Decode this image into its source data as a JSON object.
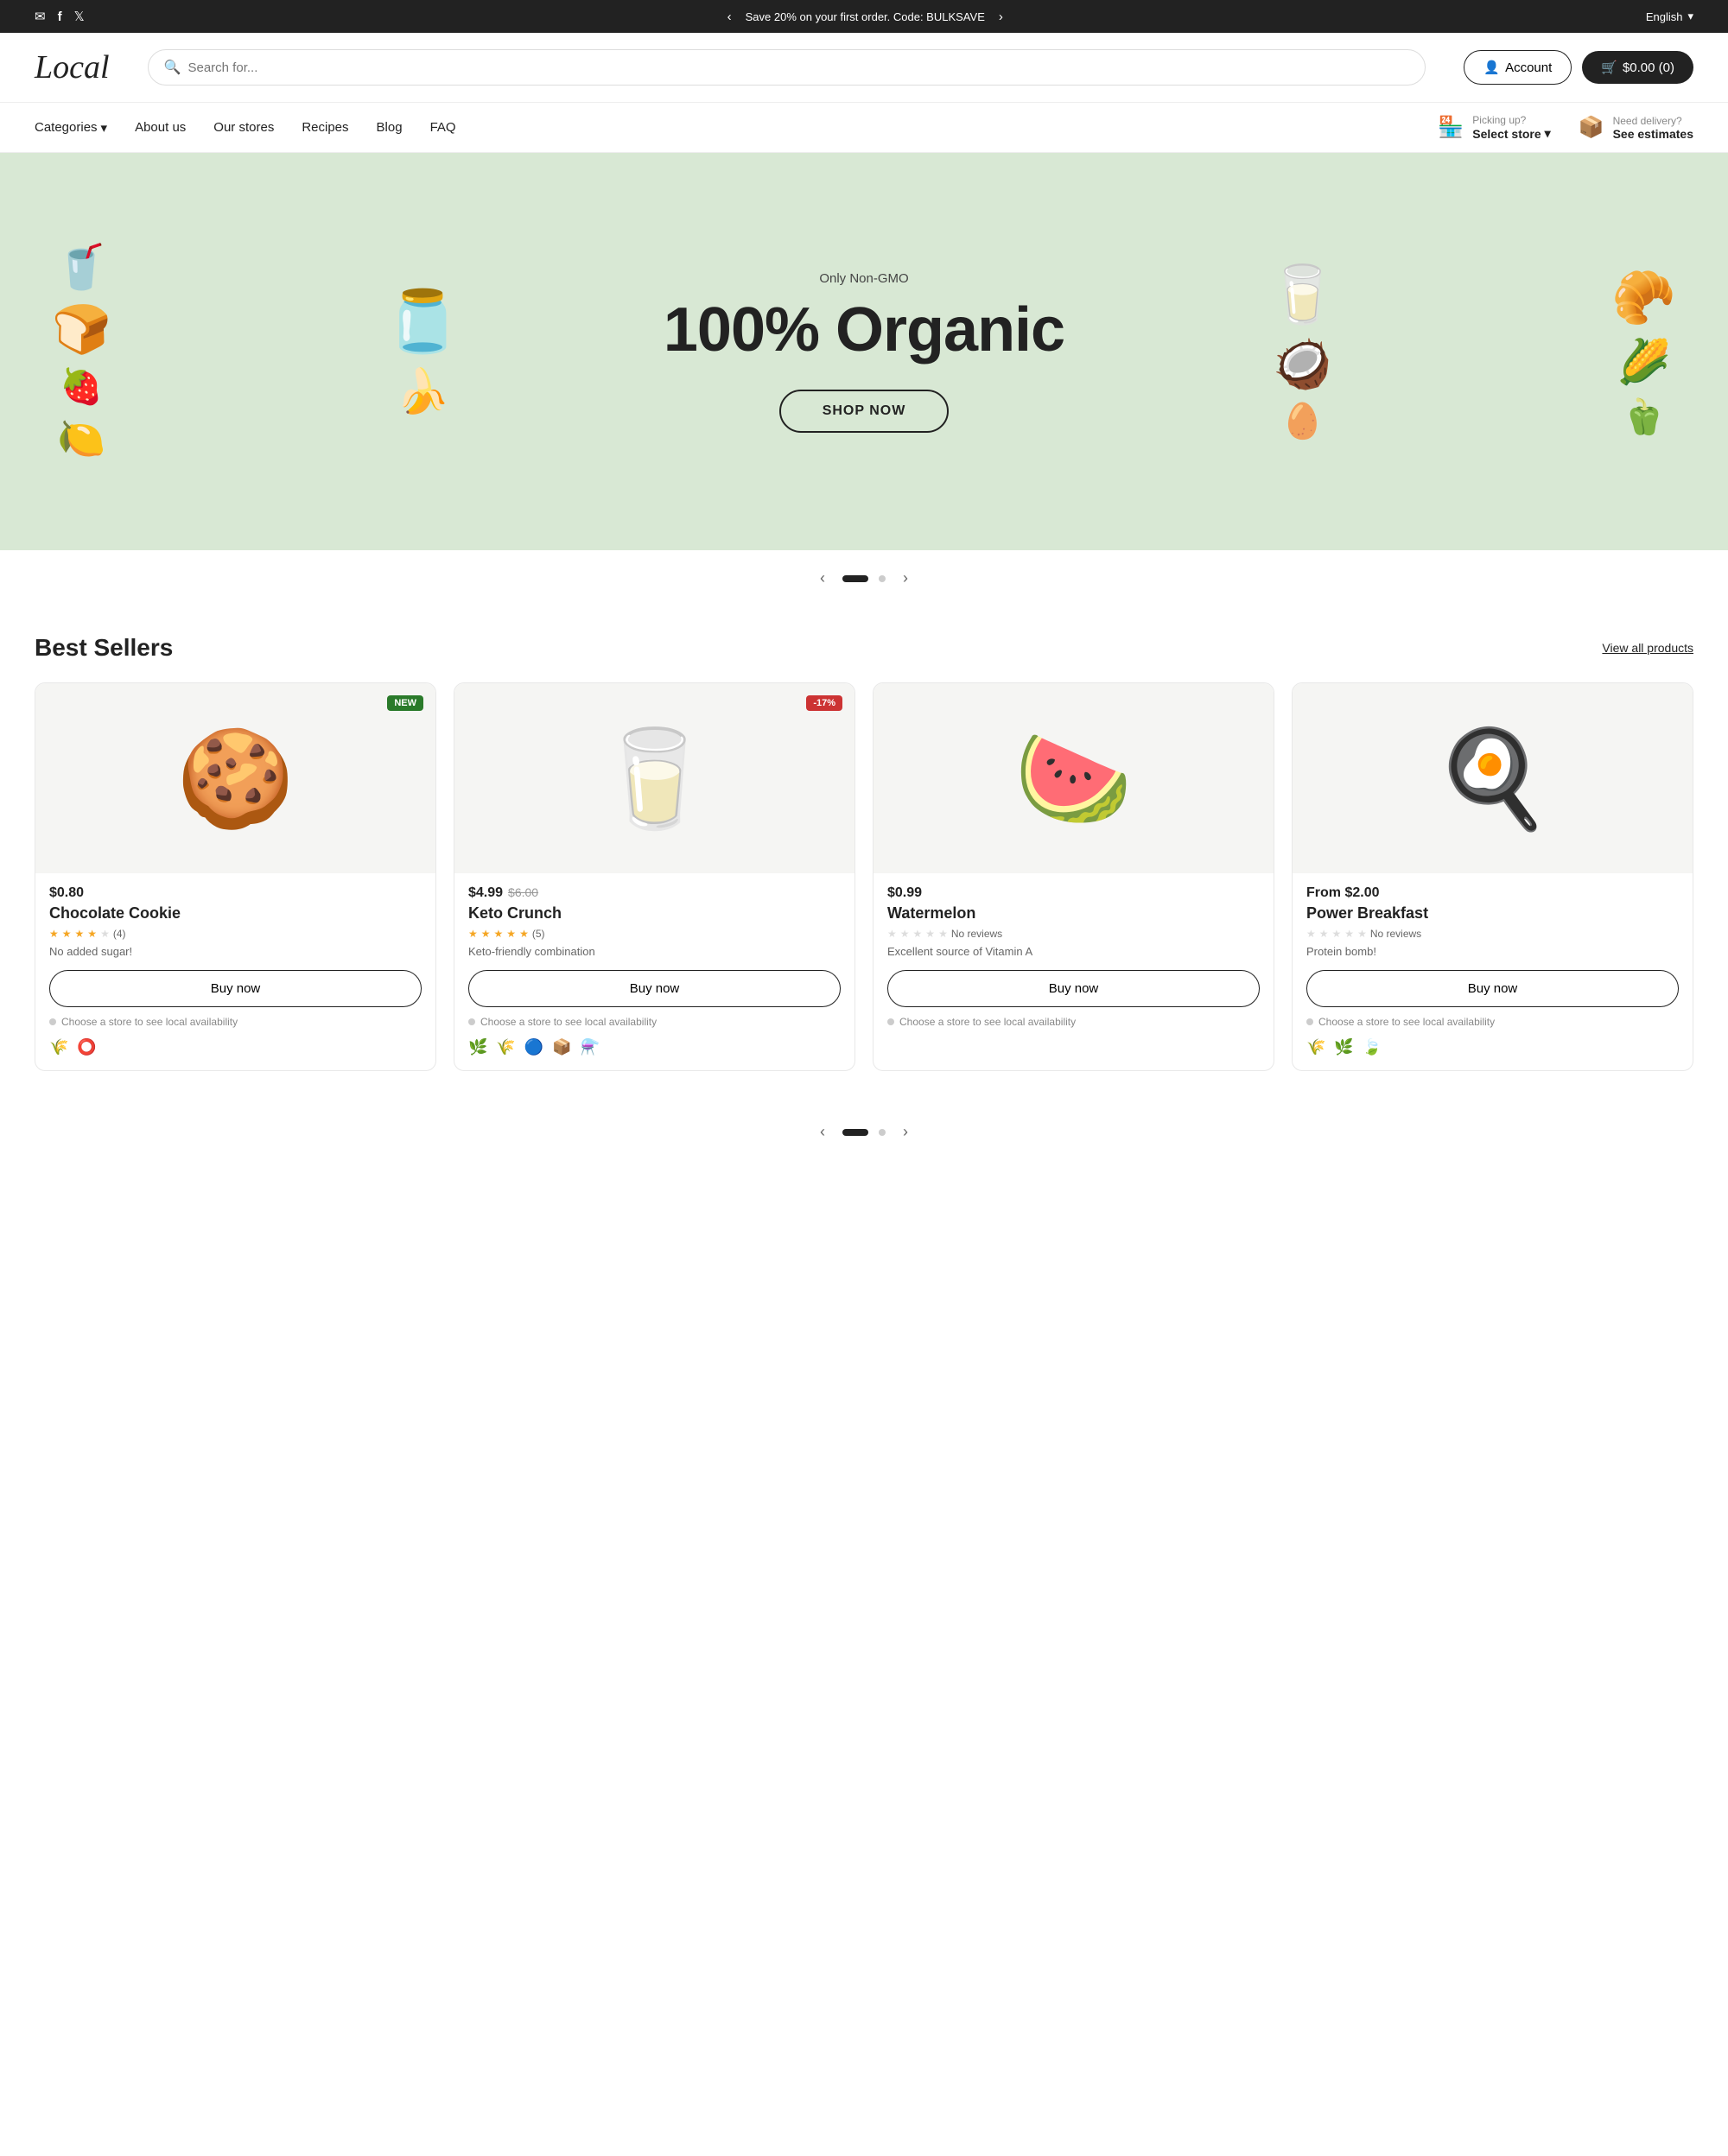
{
  "topBar": {
    "promo": "Save 20% on your first order. Code: BULKSAVE",
    "lang": "English",
    "icons": [
      "email",
      "facebook",
      "twitter"
    ]
  },
  "header": {
    "logo": "Local",
    "search": {
      "placeholder": "Search for..."
    },
    "account": "Account",
    "cart": "$0.00 (0)"
  },
  "nav": {
    "items": [
      {
        "label": "Categories",
        "hasDropdown": true
      },
      {
        "label": "About us"
      },
      {
        "label": "Our stores"
      },
      {
        "label": "Recipes"
      },
      {
        "label": "Blog"
      },
      {
        "label": "FAQ"
      }
    ],
    "pickup": {
      "label": "Picking up?",
      "value": "Select store"
    },
    "delivery": {
      "label": "Need delivery?",
      "value": "See estimates"
    }
  },
  "hero": {
    "subtitle": "Only Non-GMO",
    "title": "100% Organic",
    "cta": "SHOP NOW"
  },
  "bestSellers": {
    "title": "Best Sellers",
    "viewAll": "View all products",
    "products": [
      {
        "name": "Chocolate Cookie",
        "price": "$0.80",
        "originalPrice": null,
        "badge": "NEW",
        "badgeType": "new",
        "rating": 4,
        "reviewCount": 4,
        "desc": "No added sugar!",
        "emoji": "🍪",
        "icons": [
          "🌾",
          "⭕"
        ],
        "storeNote": "Choose a store to see local availability"
      },
      {
        "name": "Keto Crunch",
        "price": "$4.99",
        "originalPrice": "$6.00",
        "badge": "-17%",
        "badgeType": "sale",
        "rating": 5,
        "reviewCount": 5,
        "desc": "Keto-friendly combination",
        "emoji": "🥛",
        "icons": [
          "🌿",
          "🌾",
          "🔵",
          "📦",
          "⚗️"
        ],
        "storeNote": "Choose a store to see local availability"
      },
      {
        "name": "Watermelon",
        "price": "$0.99",
        "originalPrice": null,
        "badge": null,
        "badgeType": null,
        "rating": 0,
        "reviewCount": 0,
        "desc": "Excellent source of Vitamin A",
        "emoji": "🍉",
        "icons": [],
        "storeNote": "Choose a store to see local availability"
      },
      {
        "name": "Power Breakfast",
        "price": "From $2.00",
        "originalPrice": null,
        "badge": null,
        "badgeType": null,
        "rating": 0,
        "reviewCount": 0,
        "desc": "Protein bomb!",
        "emoji": "🍳",
        "icons": [
          "🌾",
          "🌿",
          "🍃"
        ],
        "storeNote": "Choose a store to see local availability"
      }
    ]
  },
  "carousel": {
    "prevLabel": "‹",
    "nextLabel": "›"
  }
}
